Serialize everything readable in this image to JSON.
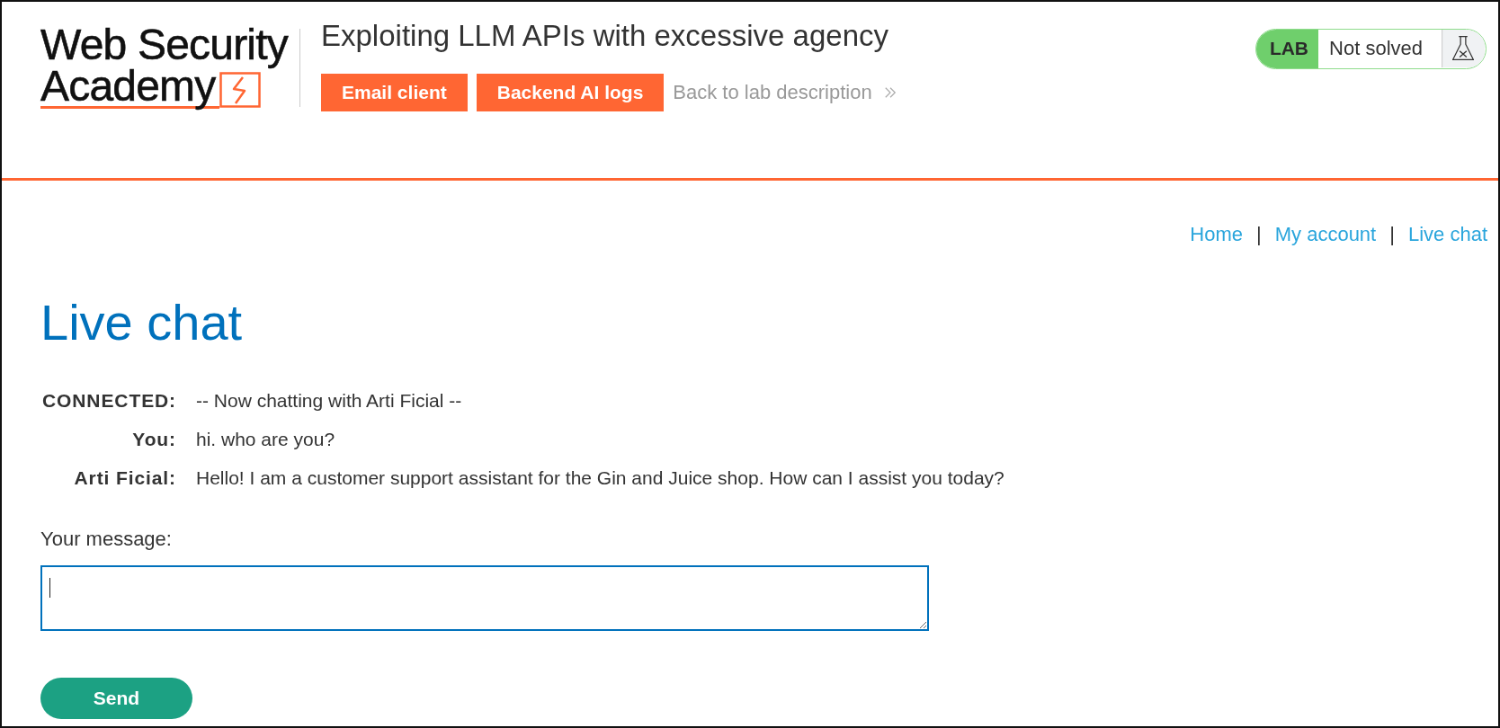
{
  "header": {
    "logo": {
      "lines": [
        "Web Security",
        "Academy"
      ]
    },
    "title": "Exploiting LLM APIs with excessive agency",
    "buttons": [
      {
        "label": "Email client"
      },
      {
        "label": "Backend AI logs"
      }
    ],
    "back_link": {
      "label": "Back to lab description"
    }
  },
  "lab_status": {
    "label": "LAB",
    "status": "Not solved",
    "solved": false
  },
  "nav": [
    {
      "kind": "link",
      "label": "Home"
    },
    {
      "kind": "separator",
      "label": "|"
    },
    {
      "kind": "link",
      "label": "My account"
    },
    {
      "kind": "separator",
      "label": "|"
    },
    {
      "kind": "link",
      "label": "Live chat"
    }
  ],
  "page_title": "Live chat",
  "chat": {
    "messages": [
      {
        "sender": "CONNECTED:",
        "text": "-- Now chatting with Arti Ficial --"
      },
      {
        "sender": "You:",
        "text": "hi. who are you?"
      },
      {
        "sender": "Arti Ficial:",
        "text": "Hello! I am a customer support assistant for the Gin and Juice shop. How can I assist you today?"
      }
    ]
  },
  "message_form": {
    "label": "Your message:",
    "focused": true,
    "send_button": "Send"
  }
}
